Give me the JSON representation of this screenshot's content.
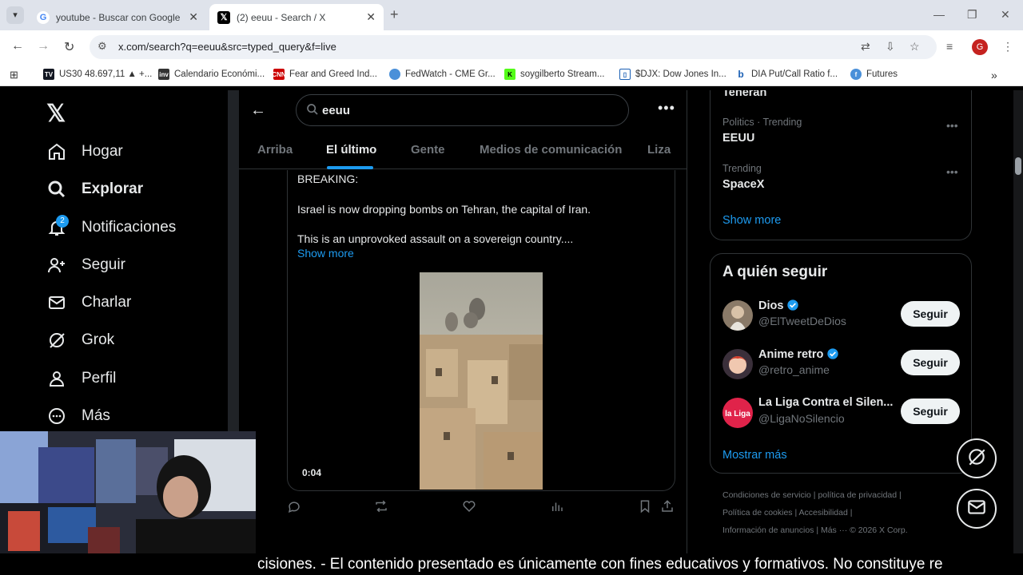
{
  "browser": {
    "tabs": [
      {
        "title": "youtube - Buscar con Google",
        "active": false
      },
      {
        "title": "(2) eeuu - Search / X",
        "active": true
      }
    ],
    "url": "x.com/search?q=eeuu&src=typed_query&f=live",
    "profile_initial": "G",
    "bookmarks": [
      {
        "label": "US30 48.697,11 ▲ +...",
        "icon": "tradingview-icon"
      },
      {
        "label": "Calendario Económi...",
        "icon": "investing-icon"
      },
      {
        "label": "Fear and Greed Ind...",
        "icon": "cnn-icon"
      },
      {
        "label": "FedWatch - CME Gr...",
        "icon": "globe-icon"
      },
      {
        "label": "soygilberto Stream...",
        "icon": "kick-icon"
      },
      {
        "label": "$DJX: Dow Jones In...",
        "icon": "barchart-icon"
      },
      {
        "label": "DIA Put/Call Ratio f...",
        "icon": "b-icon"
      },
      {
        "label": "Futures",
        "icon": "futures-icon"
      }
    ]
  },
  "sidebar": {
    "items": [
      {
        "label": "Hogar",
        "icon": "home-icon"
      },
      {
        "label": "Explorar",
        "icon": "search-icon"
      },
      {
        "label": "Notificaciones",
        "icon": "bell-icon"
      },
      {
        "label": "Seguir",
        "icon": "follow-icon"
      },
      {
        "label": "Charlar",
        "icon": "mail-icon"
      },
      {
        "label": "Grok",
        "icon": "grok-icon"
      },
      {
        "label": "Perfil",
        "icon": "person-icon"
      },
      {
        "label": "Más",
        "icon": "more-circle-icon"
      }
    ],
    "notification_count": "2"
  },
  "search": {
    "query": "eeuu",
    "tabs": [
      "Arriba",
      "El último",
      "Gente",
      "Medios de comunicación",
      "Liza"
    ],
    "active_tab": "El último"
  },
  "post": {
    "line1": "BREAKING:",
    "line2": "Israel is now dropping bombs on Tehran, the capital of Iran.",
    "line3": "This is an unprovoked assault on a sovereign country....",
    "show_more": "Show more",
    "video_duration": "0:04"
  },
  "trends": {
    "partial_top": "Teherán",
    "items": [
      {
        "category": "Politics · Trending",
        "name": "EEUU"
      },
      {
        "category": "Trending",
        "name": "SpaceX"
      }
    ],
    "show_more": "Show more"
  },
  "who_to_follow": {
    "title": "A quién seguir",
    "accounts": [
      {
        "name": "Dios",
        "handle": "@ElTweetDeDios",
        "verified": true,
        "button": "Seguir"
      },
      {
        "name": "Anime retro",
        "handle": "@retro_anime",
        "verified": true,
        "button": "Seguir"
      },
      {
        "name": "La Liga Contra el Silen...",
        "handle": "@LigaNoSilencio",
        "verified": false,
        "button": "Seguir"
      }
    ],
    "show_more": "Mostrar más"
  },
  "footer": {
    "line1": "Condiciones de servicio  |  política de privacidad  |",
    "line2": "Política de cookies  |  Accesibilidad  |",
    "line3": "Información de anuncios  |  Más ···  © 2026 X Corp."
  },
  "ticker": "cisiones.  - El contenido presentado es únicamente con fines educativos y formativos. No constituye re",
  "colors": {
    "accent": "#1d9bf0",
    "background": "#000000",
    "text": "#e7e9ea",
    "muted": "#71767b"
  }
}
